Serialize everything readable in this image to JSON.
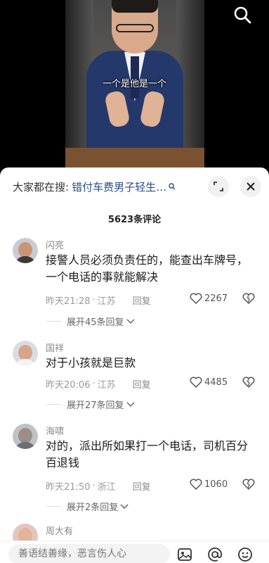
{
  "video": {
    "subtitle": "一个是他是一个",
    "search_icon": "search-icon"
  },
  "comments_panel": {
    "search_label": "大家都在搜:",
    "search_term": "错付车费男子轻生…",
    "search_term_icon": "search-icon",
    "expand_icon": "expand-icon",
    "close_icon": "close-icon",
    "count": "5623条评论",
    "comments": [
      {
        "username": "闪亮",
        "text": "接警人员必须负责任的，能查出车牌号，一个电话的事就能解决",
        "time": "昨天21:28",
        "location": "江苏",
        "reply": "回复",
        "likes": "2267",
        "expand": "展开45条回复"
      },
      {
        "username": "国祥",
        "text": "对于小孩就是巨款",
        "time": "昨天20:06",
        "location": "江苏",
        "reply": "回复",
        "likes": "4485",
        "expand": "展开27条回复"
      },
      {
        "username": "海啸",
        "text": "对的，派出所如果打一个电话，司机百分百退钱",
        "time": "昨天21:50",
        "location": "浙江",
        "reply": "回复",
        "likes": "1060",
        "expand": "展开2条回复"
      },
      {
        "username": "周大有"
      }
    ]
  },
  "input_bar": {
    "placeholder": "善语结善缘，恶言伤人心",
    "icons": [
      "image-icon",
      "at-icon",
      "emoji-icon"
    ]
  },
  "colors": {
    "link_blue": "#2a4c8c",
    "meta_gray": "#9a9a9a",
    "background": "#ffffff"
  }
}
